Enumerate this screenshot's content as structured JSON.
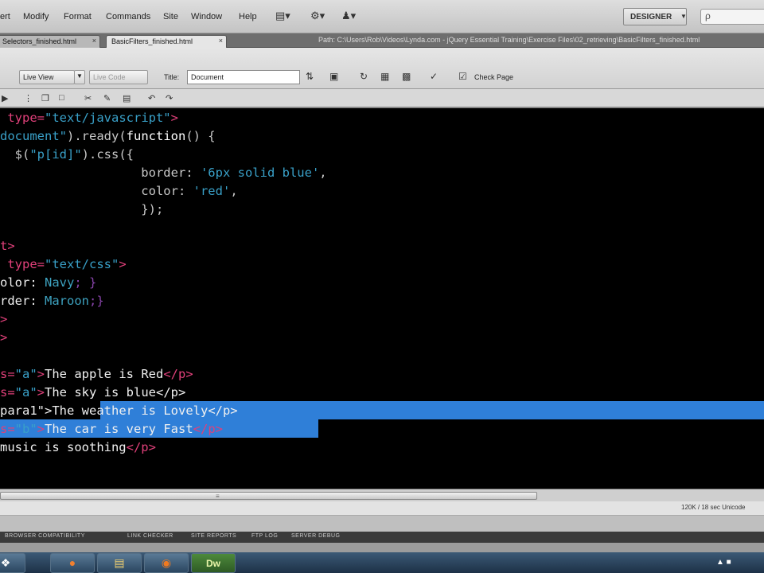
{
  "menubar": {
    "items": [
      "ert",
      "Modify",
      "Format",
      "Commands",
      "Site",
      "Window",
      "Help"
    ],
    "icons": [
      "layout-icon",
      "gear-icon",
      "user-icon"
    ],
    "workspace": "DESIGNER",
    "search_placeholder": "ρ"
  },
  "tabs": {
    "items": [
      {
        "label": "Selectors_finished.html",
        "active": false
      },
      {
        "label": "BasicFilters_finished.html",
        "active": true
      }
    ],
    "close_glyph": "×",
    "path": "Path:  C:\\Users\\Rob\\Videos\\Lynda.com - jQuery Essential Training\\Exercise Files\\02_retrieving\\BasicFilters_finished.html"
  },
  "toolbar": {
    "live_view": "Live View",
    "live_code": "Live Code",
    "title_label": "Title:",
    "title_value": "Document",
    "check_page": "Check Page"
  },
  "editor": {
    "lines": [
      {
        "y": 1,
        "selected": false,
        "segments": [
          {
            "t": " type=",
            "c": "t-tag"
          },
          {
            "t": "\"text/javascript\"",
            "c": "t-str"
          },
          {
            "t": ">",
            "c": "t-tag"
          }
        ]
      },
      {
        "y": 2,
        "selected": false,
        "segments": [
          {
            "t": "document\"",
            "c": "t-str"
          },
          {
            "t": ").ready(",
            "c": "t-grey"
          },
          {
            "t": "function",
            "c": "t-kw"
          },
          {
            "t": "() {",
            "c": "t-grey"
          }
        ]
      },
      {
        "y": 3,
        "selected": false,
        "segments": [
          {
            "t": "  $(",
            "c": "t-grey"
          },
          {
            "t": "\"p[id]\"",
            "c": "t-str"
          },
          {
            "t": ").css({",
            "c": "t-grey"
          }
        ]
      },
      {
        "y": 4,
        "selected": false,
        "segments": [
          {
            "t": "                   border: ",
            "c": "t-grey"
          },
          {
            "t": "'6px solid blue'",
            "c": "t-str"
          },
          {
            "t": ",",
            "c": "t-grey"
          }
        ]
      },
      {
        "y": 5,
        "selected": false,
        "segments": [
          {
            "t": "                   color: ",
            "c": "t-grey"
          },
          {
            "t": "'red'",
            "c": "t-str"
          },
          {
            "t": ",",
            "c": "t-grey"
          }
        ]
      },
      {
        "y": 6,
        "selected": false,
        "segments": [
          {
            "t": "                   });",
            "c": "t-grey"
          }
        ]
      },
      {
        "y": 8,
        "selected": false,
        "segments": [
          {
            "t": "t>",
            "c": "t-tag"
          }
        ]
      },
      {
        "y": 9,
        "selected": false,
        "segments": [
          {
            "t": " type=",
            "c": "t-tag"
          },
          {
            "t": "\"text/css\"",
            "c": "t-str"
          },
          {
            "t": ">",
            "c": "t-tag"
          }
        ]
      },
      {
        "y": 10,
        "selected": false,
        "segments": [
          {
            "t": "olor: ",
            "c": "t-white"
          },
          {
            "t": "Navy",
            "c": "t-navy"
          },
          {
            "t": "; }",
            "c": "t-purple"
          }
        ]
      },
      {
        "y": 11,
        "selected": false,
        "segments": [
          {
            "t": "rder: ",
            "c": "t-white"
          },
          {
            "t": "Maroon",
            "c": "t-navy"
          },
          {
            "t": ";}",
            "c": "t-purple"
          }
        ]
      },
      {
        "y": 12,
        "selected": false,
        "segments": [
          {
            "t": ">",
            "c": "t-tag"
          }
        ]
      },
      {
        "y": 13,
        "selected": false,
        "segments": [
          {
            "t": ">",
            "c": "t-tag"
          }
        ]
      },
      {
        "y": 15,
        "selected": false,
        "segments": [
          {
            "t": "s=",
            "c": "t-tag"
          },
          {
            "t": "\"a\"",
            "c": "t-str"
          },
          {
            "t": ">",
            "c": "t-tag"
          },
          {
            "t": "The apple is Red",
            "c": "t-white"
          },
          {
            "t": "</p>",
            "c": "t-tag"
          }
        ]
      },
      {
        "y": 16,
        "selected": true,
        "segments": [
          {
            "t": "s=",
            "c": "t-tag"
          },
          {
            "t": "\"a\"",
            "c": "t-str"
          },
          {
            "t": ">",
            "c": "t-tag"
          },
          {
            "t": "The sky is blue",
            "c": "t-white"
          },
          {
            "t": "</p>",
            "c": "t-white"
          }
        ]
      },
      {
        "y": 17,
        "selected": true,
        "segments": [
          {
            "t": "para1\"",
            "c": "t-white"
          },
          {
            "t": ">",
            "c": "t-white"
          },
          {
            "t": "The weather is Lovely",
            "c": "t-white"
          },
          {
            "t": "</p>",
            "c": "t-white"
          }
        ]
      },
      {
        "y": 18,
        "selected": false,
        "segments": [
          {
            "t": "s=",
            "c": "t-tag"
          },
          {
            "t": "\"b\"",
            "c": "t-str"
          },
          {
            "t": ">",
            "c": "t-tag"
          },
          {
            "t": "The car is very Fast",
            "c": "t-white"
          },
          {
            "t": "</p>",
            "c": "t-tag"
          }
        ]
      },
      {
        "y": 19,
        "selected": false,
        "segments": [
          {
            "t": "music is soothing",
            "c": "t-white"
          },
          {
            "t": "</p>",
            "c": "t-tag"
          }
        ]
      }
    ]
  },
  "statusbar": {
    "size": "120K / 18 sec  Unicode"
  },
  "panels": {
    "tabs": [
      "BROWSER COMPATIBILITY",
      "LINK CHECKER",
      "SITE REPORTS",
      "FTP LOG",
      "SERVER DEBUG"
    ]
  },
  "taskbar": {
    "buttons": [
      {
        "name": "start",
        "glyph": "❖"
      },
      {
        "name": "media",
        "glyph": "●"
      },
      {
        "name": "explorer",
        "glyph": "▤"
      },
      {
        "name": "firefox",
        "glyph": "◉"
      },
      {
        "name": "dreamweaver",
        "glyph": "Dw"
      }
    ],
    "tray": "▲  ■"
  },
  "colors": {
    "selection": "#2f7fd8",
    "tag": "#e0407a",
    "string": "#39a0c8",
    "editor_bg": "#000000"
  }
}
